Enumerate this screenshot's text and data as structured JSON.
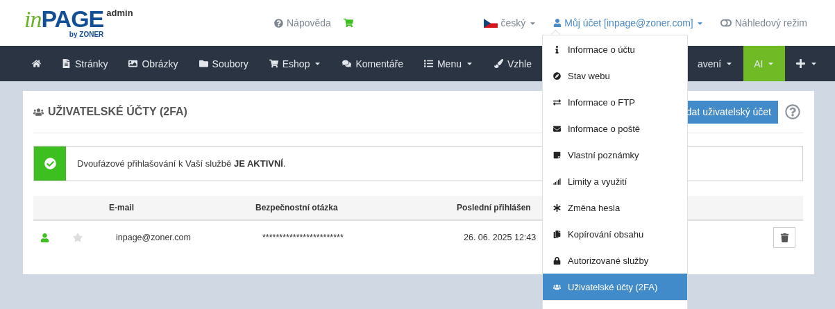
{
  "header": {
    "logo": {
      "prefix": "in",
      "brand": "PAGE",
      "byline": "by ZONER",
      "badge": "admin"
    },
    "help_link": "Nápověda",
    "language": "český",
    "account": "Můj účet [inpage@zoner.com]",
    "preview_mode": "Náhledový režim"
  },
  "nav": {
    "items": [
      {
        "caret": false,
        "highlighted": false
      },
      {
        "label": "Stránky",
        "caret": false,
        "highlighted": false
      },
      {
        "label": "Obrázky",
        "caret": false,
        "highlighted": false
      },
      {
        "label": "Soubory",
        "caret": false,
        "highlighted": false
      },
      {
        "label": "Eshop",
        "caret": true,
        "highlighted": false
      },
      {
        "label": "Komentáře",
        "caret": false,
        "highlighted": false
      },
      {
        "label": "Menu",
        "caret": true,
        "highlighted": false
      },
      {
        "label": "Vzhle",
        "caret": false,
        "highlighted": false
      }
    ],
    "right_items": [
      {
        "label": "avení",
        "caret": true,
        "highlighted": false
      },
      {
        "label": "AI",
        "caret": true,
        "highlighted": true
      },
      {
        "caret": true,
        "highlighted": false
      }
    ]
  },
  "account_menu": {
    "items": [
      {
        "label": "Informace o účtu",
        "selected": false
      },
      {
        "label": "Stav webu",
        "selected": false
      },
      {
        "label": "Informace o FTP",
        "selected": false
      },
      {
        "label": "Informace o poště",
        "selected": false
      },
      {
        "label": "Vlastní poznámky",
        "selected": false
      },
      {
        "label": "Limity a využití",
        "selected": false
      },
      {
        "label": "Změna hesla",
        "selected": false
      },
      {
        "label": "Kopírování obsahu",
        "selected": false
      },
      {
        "label": "Autorizované služby",
        "selected": false
      },
      {
        "label": "Uživatelské účty (2FA)",
        "selected": true
      }
    ]
  },
  "content": {
    "title": "UŽIVATELSKÉ ÚČTY (2FA)",
    "add_button": "dat uživatelský účet",
    "alert": {
      "text": "Dvoufázové přihlašování k Vaší službě **JE AKTIVNÍ**."
    },
    "table": {
      "columns": [
        "E-mail",
        "Bezpečnostní otázka",
        "Poslední přihlášen"
      ],
      "rows": [
        {
          "active": true,
          "favorite": false,
          "email": "inpage@zoner.com",
          "question": "************************",
          "last_login": "26. 06. 2025 12:43"
        }
      ]
    }
  }
}
